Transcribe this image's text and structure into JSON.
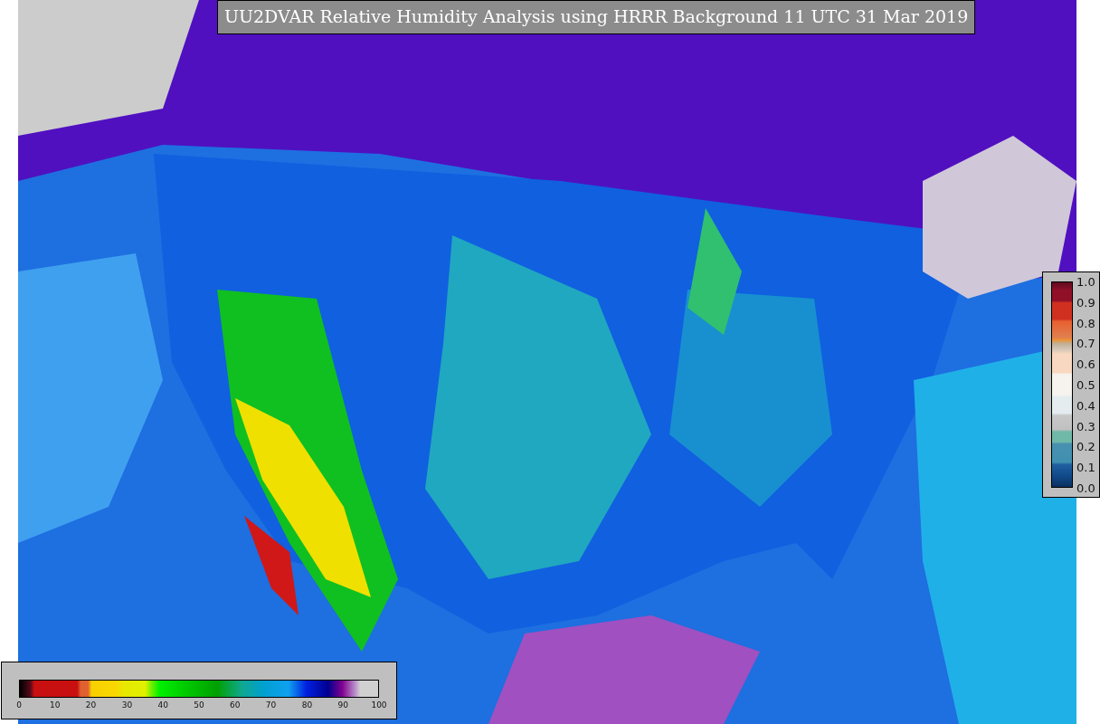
{
  "title": "UU2DVAR Relative Humidity Analysis using HRRR Background 11 UTC 31 Mar 2019",
  "humidity_legend": {
    "ticks": [
      "0",
      "10",
      "20",
      "30",
      "40",
      "50",
      "60",
      "70",
      "80",
      "90",
      "100"
    ]
  },
  "ratio_legend": {
    "ticks": [
      "1.0",
      "0.9",
      "0.8",
      "0.7",
      "0.6",
      "0.5",
      "0.4",
      "0.3",
      "0.2",
      "0.1",
      "0.0"
    ]
  }
}
